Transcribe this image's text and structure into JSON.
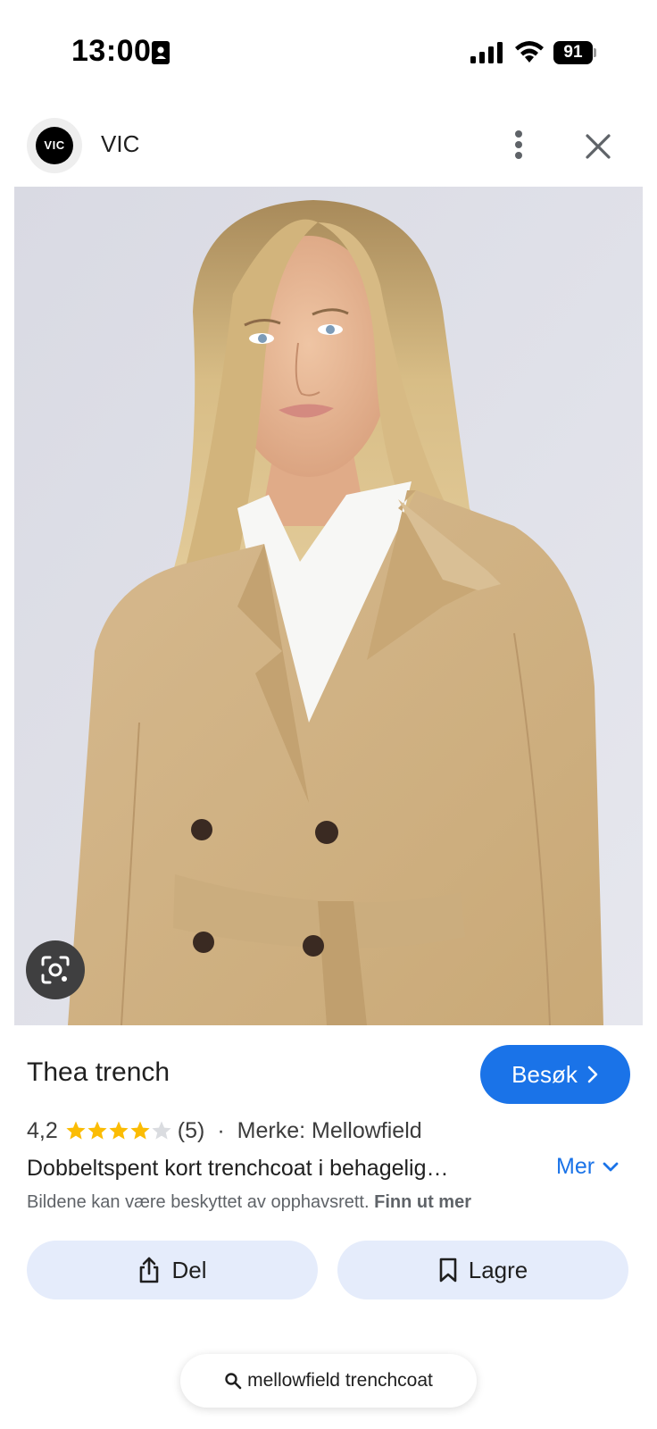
{
  "status_bar": {
    "time": "13:00",
    "battery_level": "91",
    "icons": [
      "id-card-icon",
      "cellular-signal-icon",
      "wifi-icon",
      "battery-icon"
    ]
  },
  "header": {
    "logo_text": "VIC",
    "site_name": "VIC",
    "menu_icon": "more-vert-icon",
    "close_icon": "close-icon"
  },
  "image": {
    "lens_icon": "google-lens-icon"
  },
  "product": {
    "title": "Thea trench",
    "visit_label": "Besøk",
    "rating": "4,2",
    "rating_value": 4.2,
    "rating_max": 5,
    "review_count": "(5)",
    "separator": "·",
    "brand": "Merke: Mellowfield",
    "description": "Dobbeltspent kort trenchcoat i behagelig…",
    "more_label": "Mer",
    "copyright_text": "Bildene kan være beskyttet av opphavsrett.",
    "copyright_link": "Finn ut mer"
  },
  "actions": {
    "share_label": "Del",
    "save_label": "Lagre"
  },
  "search": {
    "query": "mellowfield trenchcoat"
  },
  "colors": {
    "accent": "#1a73e8",
    "action_button_bg": "#e5ecfb",
    "star": "#fbbc04",
    "star_empty": "#dadce0"
  }
}
